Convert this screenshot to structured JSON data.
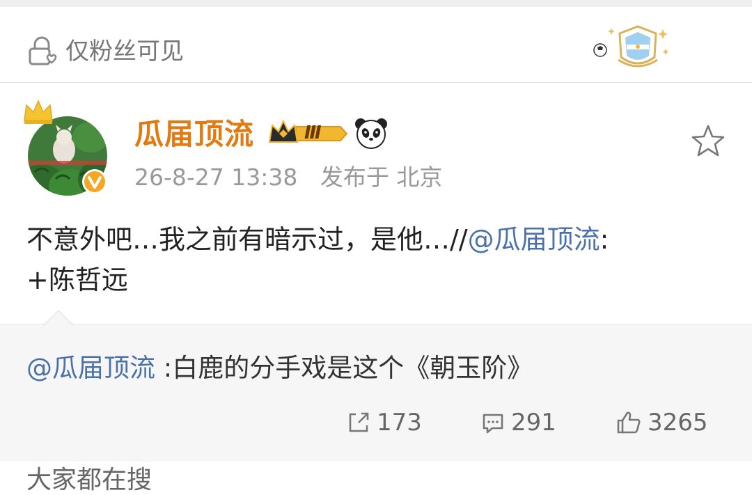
{
  "visibility": {
    "label": "仅粉丝可见",
    "icon": "lock-heart-icon"
  },
  "post": {
    "author": "瓜届顶流",
    "vip_level": "Ⅲ",
    "timestamp": "26-8-27 13:38",
    "location": "发布于 北京",
    "body_text": "不意外吧…我之前有暗示过，是他…//",
    "body_mention": "@瓜届顶流",
    "body_suffix": ":",
    "body_line2": "+陈哲远"
  },
  "repost": {
    "mention": "@瓜届顶流",
    "text": " :白鹿的分手戏是这个《朝玉阶》"
  },
  "actions": {
    "share_count": "173",
    "comment_count": "291",
    "like_count": "3265"
  },
  "trending": {
    "label": "大家都在搜"
  },
  "colors": {
    "username": "#e27a12",
    "mention": "#4a72a8",
    "meta": "#999999",
    "vip_gold": "#f2b731",
    "verified": "#f5a623"
  }
}
